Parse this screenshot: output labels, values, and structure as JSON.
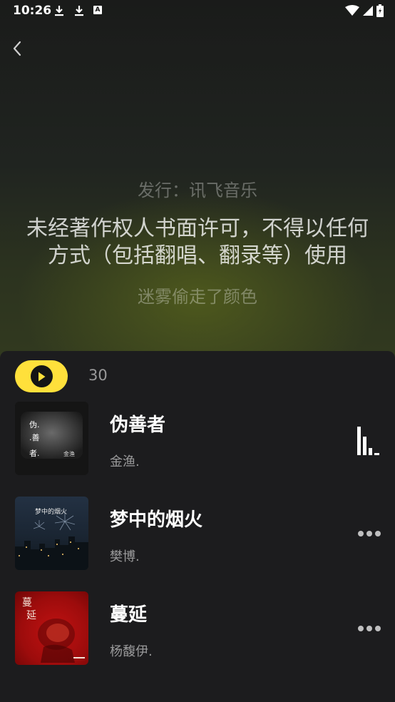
{
  "status_bar": {
    "time": "10:26",
    "icons": [
      "download-icon",
      "download-icon",
      "a-icon",
      "wifi-icon",
      "signal-icon",
      "battery-icon"
    ],
    "a_badge": "A"
  },
  "hero": {
    "lyrics": [
      "发行：讯飞音乐",
      "未经著作权人书面许可，不得以任何方式（包括翻唱、翻录等）使用",
      "迷雾偷走了颜色"
    ]
  },
  "playlist": {
    "count": "30",
    "accent_color": "#ffe03b",
    "songs": [
      {
        "title": "伪善者",
        "artist": "金渔.",
        "state": "playing",
        "cover_text": [
          "伪.",
          ".善",
          "者.",
          "金渔"
        ]
      },
      {
        "title": "梦中的烟火",
        "artist": "樊博.",
        "state": "idle",
        "cover_text": [
          "梦中的烟火"
        ]
      },
      {
        "title": "蔓延",
        "artist": "杨馥伊.",
        "state": "idle",
        "cover_text": [
          "蔓",
          "延"
        ]
      }
    ]
  }
}
